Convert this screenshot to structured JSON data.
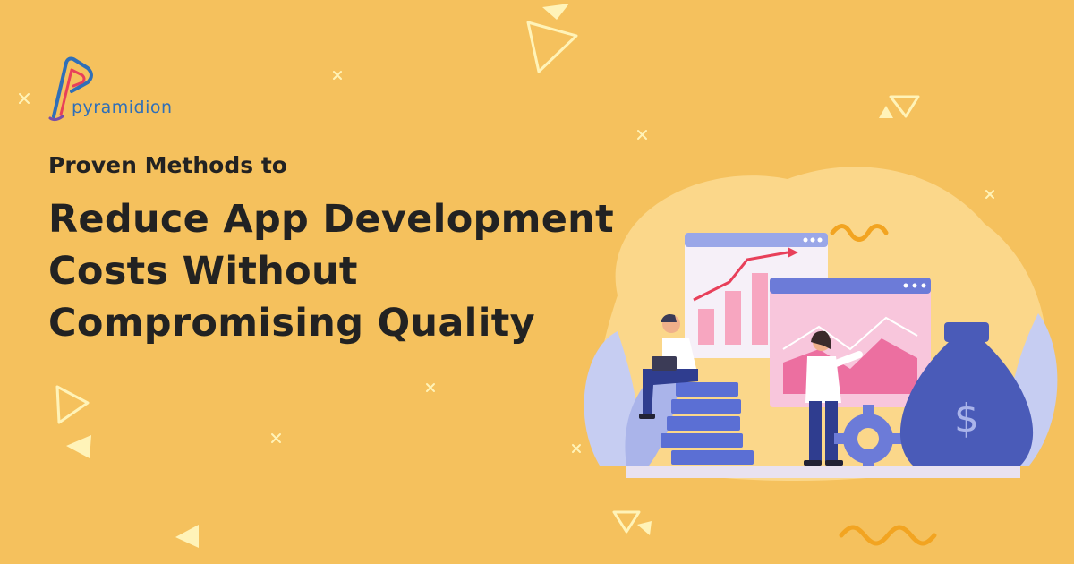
{
  "brand": {
    "name": "pyramidion",
    "colors": {
      "primary": "#2f6fb8",
      "accent": "#e8405a",
      "background": "#f5c15d",
      "text": "#222222"
    }
  },
  "heading": {
    "kicker": "Proven Methods to",
    "lines": [
      "Reduce App Development",
      "Costs Without",
      "Compromising Quality"
    ]
  },
  "illustration": {
    "icons": [
      "line-chart-window-icon",
      "area-chart-window-icon",
      "money-bag-icon",
      "dollar-icon",
      "gear-icon",
      "coin-stack-icon"
    ]
  }
}
